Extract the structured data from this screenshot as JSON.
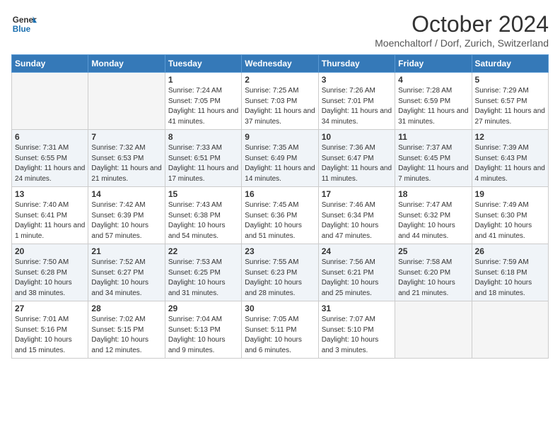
{
  "header": {
    "logo_general": "General",
    "logo_blue": "Blue",
    "month_title": "October 2024",
    "subtitle": "Moenchaltorf / Dorf, Zurich, Switzerland"
  },
  "weekdays": [
    "Sunday",
    "Monday",
    "Tuesday",
    "Wednesday",
    "Thursday",
    "Friday",
    "Saturday"
  ],
  "weeks": [
    [
      {
        "day": "",
        "empty": true
      },
      {
        "day": "",
        "empty": true
      },
      {
        "day": "1",
        "sunrise": "Sunrise: 7:24 AM",
        "sunset": "Sunset: 7:05 PM",
        "daylight": "Daylight: 11 hours and 41 minutes."
      },
      {
        "day": "2",
        "sunrise": "Sunrise: 7:25 AM",
        "sunset": "Sunset: 7:03 PM",
        "daylight": "Daylight: 11 hours and 37 minutes."
      },
      {
        "day": "3",
        "sunrise": "Sunrise: 7:26 AM",
        "sunset": "Sunset: 7:01 PM",
        "daylight": "Daylight: 11 hours and 34 minutes."
      },
      {
        "day": "4",
        "sunrise": "Sunrise: 7:28 AM",
        "sunset": "Sunset: 6:59 PM",
        "daylight": "Daylight: 11 hours and 31 minutes."
      },
      {
        "day": "5",
        "sunrise": "Sunrise: 7:29 AM",
        "sunset": "Sunset: 6:57 PM",
        "daylight": "Daylight: 11 hours and 27 minutes."
      }
    ],
    [
      {
        "day": "6",
        "sunrise": "Sunrise: 7:31 AM",
        "sunset": "Sunset: 6:55 PM",
        "daylight": "Daylight: 11 hours and 24 minutes."
      },
      {
        "day": "7",
        "sunrise": "Sunrise: 7:32 AM",
        "sunset": "Sunset: 6:53 PM",
        "daylight": "Daylight: 11 hours and 21 minutes."
      },
      {
        "day": "8",
        "sunrise": "Sunrise: 7:33 AM",
        "sunset": "Sunset: 6:51 PM",
        "daylight": "Daylight: 11 hours and 17 minutes."
      },
      {
        "day": "9",
        "sunrise": "Sunrise: 7:35 AM",
        "sunset": "Sunset: 6:49 PM",
        "daylight": "Daylight: 11 hours and 14 minutes."
      },
      {
        "day": "10",
        "sunrise": "Sunrise: 7:36 AM",
        "sunset": "Sunset: 6:47 PM",
        "daylight": "Daylight: 11 hours and 11 minutes."
      },
      {
        "day": "11",
        "sunrise": "Sunrise: 7:37 AM",
        "sunset": "Sunset: 6:45 PM",
        "daylight": "Daylight: 11 hours and 7 minutes."
      },
      {
        "day": "12",
        "sunrise": "Sunrise: 7:39 AM",
        "sunset": "Sunset: 6:43 PM",
        "daylight": "Daylight: 11 hours and 4 minutes."
      }
    ],
    [
      {
        "day": "13",
        "sunrise": "Sunrise: 7:40 AM",
        "sunset": "Sunset: 6:41 PM",
        "daylight": "Daylight: 11 hours and 1 minute."
      },
      {
        "day": "14",
        "sunrise": "Sunrise: 7:42 AM",
        "sunset": "Sunset: 6:39 PM",
        "daylight": "Daylight: 10 hours and 57 minutes."
      },
      {
        "day": "15",
        "sunrise": "Sunrise: 7:43 AM",
        "sunset": "Sunset: 6:38 PM",
        "daylight": "Daylight: 10 hours and 54 minutes."
      },
      {
        "day": "16",
        "sunrise": "Sunrise: 7:45 AM",
        "sunset": "Sunset: 6:36 PM",
        "daylight": "Daylight: 10 hours and 51 minutes."
      },
      {
        "day": "17",
        "sunrise": "Sunrise: 7:46 AM",
        "sunset": "Sunset: 6:34 PM",
        "daylight": "Daylight: 10 hours and 47 minutes."
      },
      {
        "day": "18",
        "sunrise": "Sunrise: 7:47 AM",
        "sunset": "Sunset: 6:32 PM",
        "daylight": "Daylight: 10 hours and 44 minutes."
      },
      {
        "day": "19",
        "sunrise": "Sunrise: 7:49 AM",
        "sunset": "Sunset: 6:30 PM",
        "daylight": "Daylight: 10 hours and 41 minutes."
      }
    ],
    [
      {
        "day": "20",
        "sunrise": "Sunrise: 7:50 AM",
        "sunset": "Sunset: 6:28 PM",
        "daylight": "Daylight: 10 hours and 38 minutes."
      },
      {
        "day": "21",
        "sunrise": "Sunrise: 7:52 AM",
        "sunset": "Sunset: 6:27 PM",
        "daylight": "Daylight: 10 hours and 34 minutes."
      },
      {
        "day": "22",
        "sunrise": "Sunrise: 7:53 AM",
        "sunset": "Sunset: 6:25 PM",
        "daylight": "Daylight: 10 hours and 31 minutes."
      },
      {
        "day": "23",
        "sunrise": "Sunrise: 7:55 AM",
        "sunset": "Sunset: 6:23 PM",
        "daylight": "Daylight: 10 hours and 28 minutes."
      },
      {
        "day": "24",
        "sunrise": "Sunrise: 7:56 AM",
        "sunset": "Sunset: 6:21 PM",
        "daylight": "Daylight: 10 hours and 25 minutes."
      },
      {
        "day": "25",
        "sunrise": "Sunrise: 7:58 AM",
        "sunset": "Sunset: 6:20 PM",
        "daylight": "Daylight: 10 hours and 21 minutes."
      },
      {
        "day": "26",
        "sunrise": "Sunrise: 7:59 AM",
        "sunset": "Sunset: 6:18 PM",
        "daylight": "Daylight: 10 hours and 18 minutes."
      }
    ],
    [
      {
        "day": "27",
        "sunrise": "Sunrise: 7:01 AM",
        "sunset": "Sunset: 5:16 PM",
        "daylight": "Daylight: 10 hours and 15 minutes."
      },
      {
        "day": "28",
        "sunrise": "Sunrise: 7:02 AM",
        "sunset": "Sunset: 5:15 PM",
        "daylight": "Daylight: 10 hours and 12 minutes."
      },
      {
        "day": "29",
        "sunrise": "Sunrise: 7:04 AM",
        "sunset": "Sunset: 5:13 PM",
        "daylight": "Daylight: 10 hours and 9 minutes."
      },
      {
        "day": "30",
        "sunrise": "Sunrise: 7:05 AM",
        "sunset": "Sunset: 5:11 PM",
        "daylight": "Daylight: 10 hours and 6 minutes."
      },
      {
        "day": "31",
        "sunrise": "Sunrise: 7:07 AM",
        "sunset": "Sunset: 5:10 PM",
        "daylight": "Daylight: 10 hours and 3 minutes."
      },
      {
        "day": "",
        "empty": true
      },
      {
        "day": "",
        "empty": true
      }
    ]
  ]
}
